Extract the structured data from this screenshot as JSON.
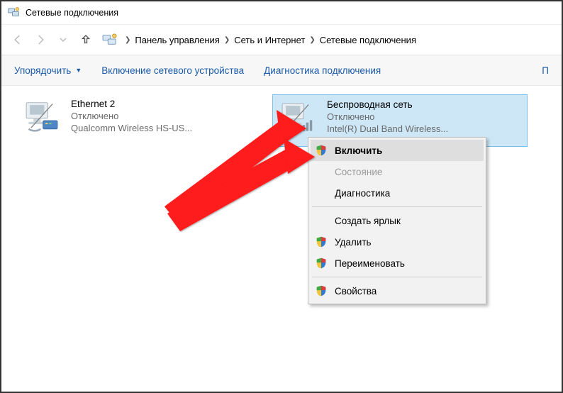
{
  "window": {
    "title": "Сетевые подключения"
  },
  "breadcrumb": {
    "items": [
      "Панель управления",
      "Сеть и Интернет",
      "Сетевые подключения"
    ]
  },
  "commands": {
    "organize": "Упорядочить",
    "enable_device": "Включение сетевого устройства",
    "diagnose": "Диагностика подключения",
    "more": "П"
  },
  "adapters": [
    {
      "name": "Ethernet 2",
      "status": "Отключено",
      "hw": "Qualcomm Wireless HS-US..."
    },
    {
      "name": "Беспроводная сеть",
      "status": "Отключено",
      "hw": "Intel(R) Dual Band Wireless..."
    }
  ],
  "context_menu": {
    "enable": "Включить",
    "status": "Состояние",
    "diagnose": "Диагностика",
    "shortcut": "Создать ярлык",
    "delete": "Удалить",
    "rename": "Переименовать",
    "properties": "Свойства"
  }
}
